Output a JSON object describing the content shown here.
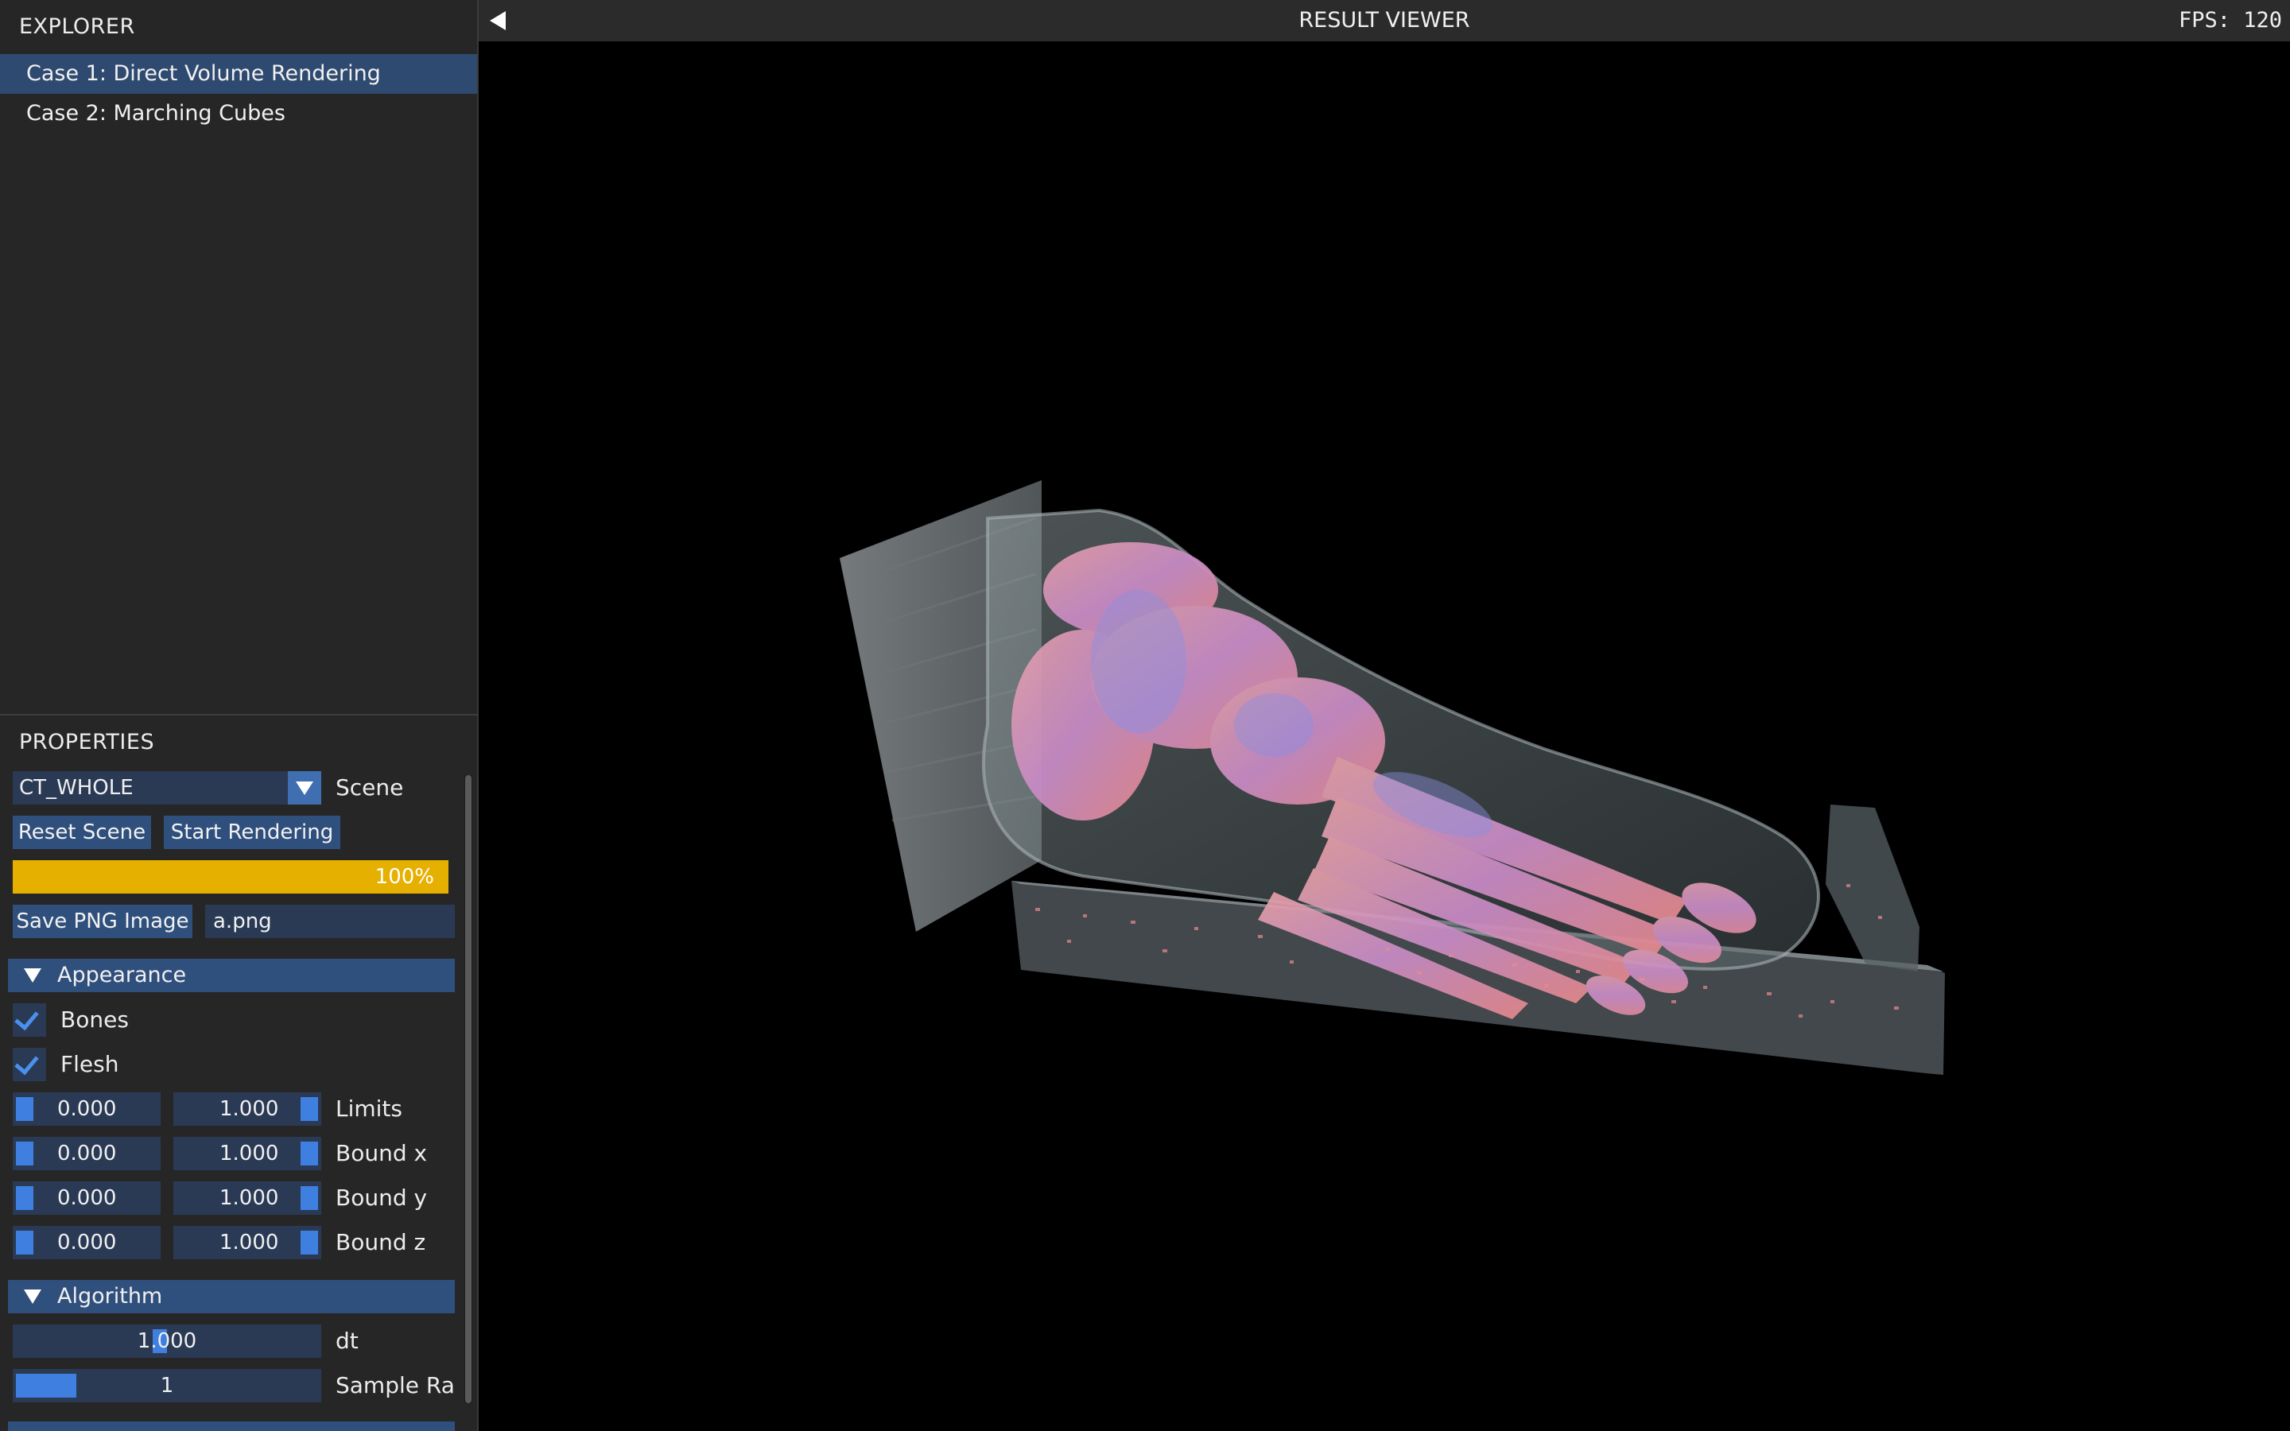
{
  "explorer": {
    "title": "EXPLORER",
    "items": [
      {
        "label": "Case 1: Direct Volume Rendering",
        "selected": true
      },
      {
        "label": "Case 2: Marching Cubes",
        "selected": false
      }
    ]
  },
  "properties": {
    "title": "PROPERTIES",
    "scene_value": "CT_WHOLE",
    "scene_label": "Scene",
    "reset_label": "Reset Scene",
    "start_label": "Start Rendering",
    "progress_text": "100%",
    "progress_fraction": 1.0,
    "progress_color": "#e6b000",
    "save_label": "Save PNG Image",
    "filename": "a.png",
    "appearance": {
      "header": "Appearance",
      "bones_label": "Bones",
      "bones_checked": true,
      "flesh_label": "Flesh",
      "flesh_checked": true,
      "ranges": [
        {
          "min": "0.000",
          "max": "1.000",
          "label": "Limits"
        },
        {
          "min": "0.000",
          "max": "1.000",
          "label": "Bound x"
        },
        {
          "min": "0.000",
          "max": "1.000",
          "label": "Bound y"
        },
        {
          "min": "0.000",
          "max": "1.000",
          "label": "Bound z"
        }
      ]
    },
    "algorithm": {
      "header": "Algorithm",
      "dt_value": "1.000",
      "dt_label": "dt",
      "sample_value": "1",
      "sample_label": "Sample Rat"
    }
  },
  "viewer": {
    "title": "RESULT VIEWER",
    "fps": "FPS: 120"
  },
  "colors": {
    "accent": "#3f7fe0",
    "selection": "#2f4a70",
    "button": "#2f4f7d",
    "bone": "#e98a8e",
    "bone_highlight": "#8b8fe0",
    "tissue": "#7a8a8e"
  },
  "icons": [
    "collapse-left-icon",
    "chevron-down-icon",
    "checkmark-icon",
    "triangle-down-icon"
  ]
}
